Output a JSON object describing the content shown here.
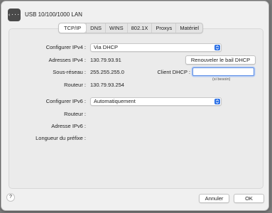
{
  "window": {
    "title": "USB 10/100/1000 LAN",
    "app_icon_glyph": "‹···›"
  },
  "tabs": [
    "TCP/IP",
    "DNS",
    "WINS",
    "802.1X",
    "Proxys",
    "Matériel"
  ],
  "active_tab": "TCP/IP",
  "ipv4": {
    "configure_label": "Configurer IPv4 :",
    "configure_value": "Via DHCP",
    "address_label": "Adresses IPv4 :",
    "address_value": "130.79.93.91",
    "renew_button": "Renouveler le bail DHCP",
    "subnet_label": "Sous-réseau :",
    "subnet_value": "255.255.255.0",
    "client_label": "Client DHCP :",
    "client_value": "",
    "client_hint": "(si besoin)",
    "router_label": "Routeur :",
    "router_value": "130.79.93.254"
  },
  "ipv6": {
    "configure_label": "Configurer IPv6 :",
    "configure_value": "Automatiquement",
    "router_label": "Routeur :",
    "address_label": "Adresse IPv6 :",
    "prefix_label": "Longueur du préfixe :"
  },
  "footer": {
    "help_label": "?",
    "cancel_button": "Annuler",
    "ok_button": "OK"
  },
  "colors": {
    "accent": "#2e72e6",
    "focus_ring": "#5b8de6"
  },
  "icons": {
    "app": "network-interface-icon",
    "stepper": "chevron-up-down-icon"
  }
}
